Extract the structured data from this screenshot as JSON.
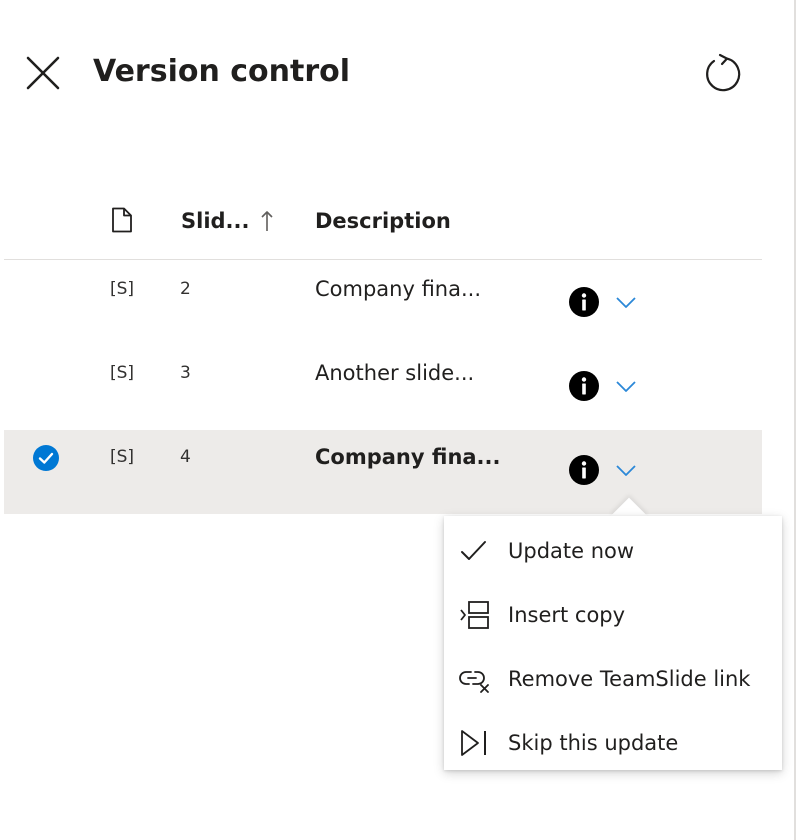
{
  "header": {
    "title": "Version control",
    "close_icon": "close-icon",
    "refresh_icon": "refresh-icon"
  },
  "columns": {
    "file_icon": "file-icon",
    "slide": "Slid...",
    "sort_icon": "sort-ascending-icon",
    "description": "Description"
  },
  "rows": [
    {
      "tag": "[S]",
      "number": "2",
      "description": "Company fina...",
      "selected": false
    },
    {
      "tag": "[S]",
      "number": "3",
      "description": "Another slide...",
      "selected": false
    },
    {
      "tag": "[S]",
      "number": "4",
      "description": "Company fina...",
      "selected": true
    }
  ],
  "menu": {
    "items": [
      {
        "label": "Update now",
        "icon": "checkmark-icon"
      },
      {
        "label": "Insert copy",
        "icon": "insert-copy-icon"
      },
      {
        "label": "Remove TeamSlide link",
        "icon": "unlink-icon"
      },
      {
        "label": "Skip this update",
        "icon": "skip-icon"
      }
    ]
  },
  "colors": {
    "accent": "#0078d4",
    "selected_row": "#edebe9",
    "chevron": "#2b88d8",
    "text": "#201f1e"
  }
}
